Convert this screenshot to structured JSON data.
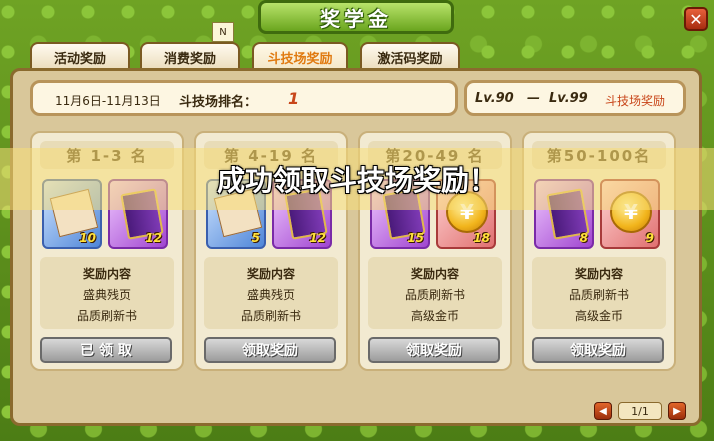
{
  "window": {
    "title": "奖学金",
    "close_label": "✕"
  },
  "tabs": [
    {
      "label": "活动奖励"
    },
    {
      "label": "消费奖励"
    },
    {
      "label": "斗技场奖励"
    },
    {
      "label": "激活码奖励"
    }
  ],
  "new_badge": "N",
  "info": {
    "date_range": "11月6日-11月13日",
    "rank_label": "斗技场排名：",
    "rank_value": "1",
    "level_low": "Lv.90",
    "level_sep": "—",
    "level_high": "Lv.99",
    "arena_reward": "斗技场奖励"
  },
  "cards": [
    {
      "title": "第 1-3 名",
      "items": [
        {
          "icon": "page-fragment-icon",
          "qty": "10"
        },
        {
          "icon": "quality-book-icon",
          "qty": "12"
        }
      ],
      "contents_head": "奖励内容",
      "contents": [
        "盛典残页",
        "品质刷新书"
      ],
      "button": "已 领 取"
    },
    {
      "title": "第 4-19 名",
      "items": [
        {
          "icon": "page-fragment-icon",
          "qty": "5"
        },
        {
          "icon": "quality-book-icon",
          "qty": "12"
        }
      ],
      "contents_head": "奖励内容",
      "contents": [
        "盛典残页",
        "品质刷新书"
      ],
      "button": "领取奖励"
    },
    {
      "title": "第20-49 名",
      "items": [
        {
          "icon": "quality-book-icon",
          "qty": "15"
        },
        {
          "icon": "gold-coin-icon",
          "qty": "18"
        }
      ],
      "contents_head": "奖励内容",
      "contents": [
        "品质刷新书",
        "高级金币"
      ],
      "button": "领取奖励"
    },
    {
      "title": "第50-100名",
      "items": [
        {
          "icon": "quality-book-icon",
          "qty": "8"
        },
        {
          "icon": "gold-coin-icon",
          "qty": "9"
        }
      ],
      "contents_head": "奖励内容",
      "contents": [
        "品质刷新书",
        "高级金币"
      ],
      "button": "领取奖励"
    }
  ],
  "coin_symbol": "¥",
  "toast": "成功领取斗技场奖励！",
  "pager": {
    "page": "1/1",
    "prev": "◀",
    "next": "▶"
  }
}
